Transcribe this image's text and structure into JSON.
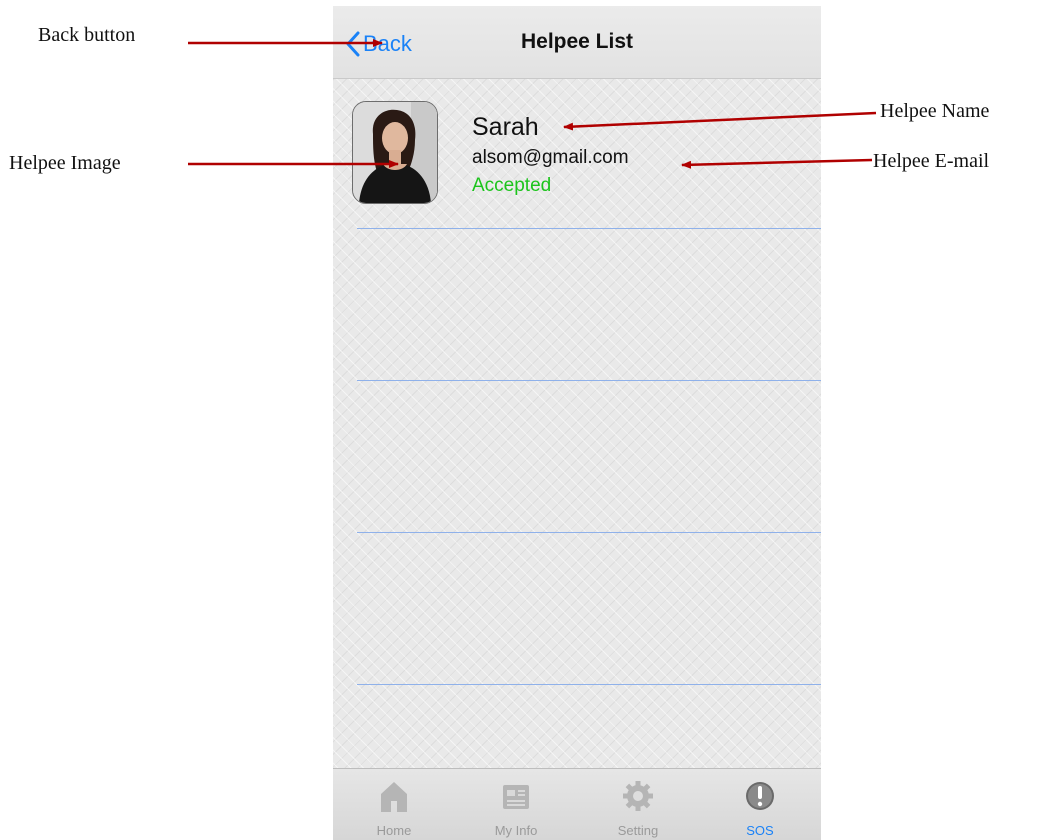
{
  "annotations": {
    "back_button": "Back button",
    "helpee_image": "Helpee Image",
    "helpee_name": "Helpee Name",
    "helpee_email": "Helpee E-mail"
  },
  "navbar": {
    "back_label": "Back",
    "title": "Helpee List"
  },
  "helpees": [
    {
      "name": "Sarah",
      "email": "alsom@gmail.com",
      "status": "Accepted"
    }
  ],
  "tabbar": {
    "tabs": [
      {
        "label": "Home",
        "icon": "home-icon"
      },
      {
        "label": "My Info",
        "icon": "newspaper-icon"
      },
      {
        "label": "Setting",
        "icon": "gear-icon"
      },
      {
        "label": "SOS",
        "icon": "alert-icon",
        "active": true
      }
    ]
  },
  "colors": {
    "accent": "#1a82f7",
    "status_accepted": "#1cc41c",
    "annotation_arrow": "#b00000",
    "separator": "#8fb1ea"
  }
}
